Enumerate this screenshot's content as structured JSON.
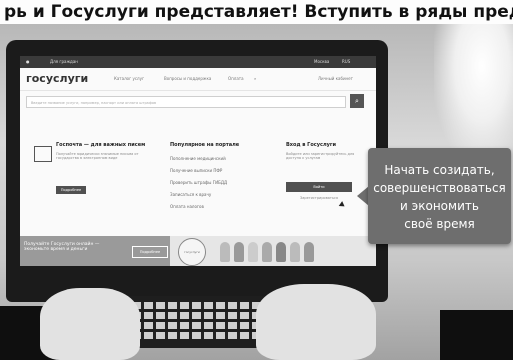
{
  "caption": "рь и Госуслуги представляет! Вступить в ряды предсказуемого",
  "site": {
    "topbar": {
      "region_left": "Для граждан",
      "city": "Москва",
      "lang": "RUS"
    },
    "logo": "госуслуги",
    "nav_links": [
      "Каталог услуг",
      "Вопросы и поддержка",
      "Оплата"
    ],
    "cabinet": "Личный кабинет",
    "search_placeholder": "Введите название услуги, например, паспорт или оплата штрафов",
    "column1": {
      "title": "Госпочта — для важных писем",
      "text": "Получайте юридически значимые письма от государства в электронном виде",
      "button": "Подробнее"
    },
    "column2": {
      "title": "Популярное на портале",
      "links": [
        "Пополнение медицинский",
        "Получение выписки ПФР",
        "Проверить штрафы ГИБДД",
        "Записаться к врачу",
        "Оплата налогов"
      ]
    },
    "column3": {
      "title": "Вход в Госуслуги",
      "text": "Войдите или зарегистрируйтесь для доступа к услугам",
      "button": "Войти",
      "link": "Зарегистрироваться"
    },
    "banner": {
      "text_line1": "Получайте Госуслуги онлайн —",
      "text_line2": "экономьте время и деньги",
      "button": "Подробнее",
      "stamp": "госуслуги"
    }
  },
  "callout": {
    "lines": [
      "Начать созидать,",
      "совершенствоваться",
      "и экономить",
      "своё время"
    ]
  }
}
